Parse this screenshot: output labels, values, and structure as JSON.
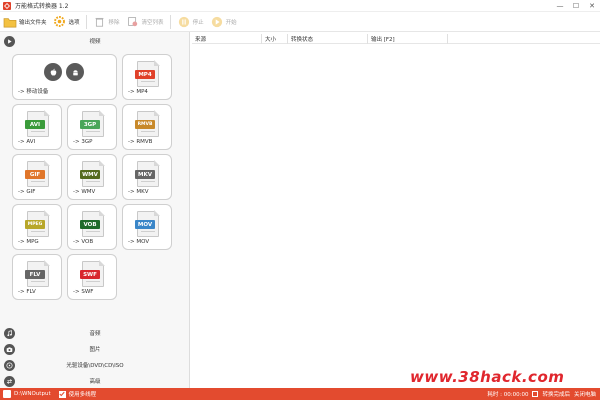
{
  "window": {
    "title": "万能格式转换器 1.2",
    "controls": [
      "minimize-icon",
      "maximize-icon",
      "close-icon"
    ]
  },
  "toolbar": {
    "output_folder": "输出文件夹",
    "options": "选项",
    "remove": "移除",
    "clear_list": "清空列表",
    "stop": "停止",
    "start": "开始"
  },
  "categories": {
    "video": "视频",
    "audio": "音频",
    "image": "图片",
    "disc": "光驱设备\\DVD\\CD\\ISO",
    "advanced": "高级"
  },
  "formats": [
    {
      "label": "-> 移动设备",
      "badge": "",
      "color": "#555555"
    },
    {
      "label": "-> MP4",
      "badge": "MP4",
      "color": "#e0412a"
    },
    {
      "label": "-> AVI",
      "badge": "AVI",
      "color": "#3a9b3a"
    },
    {
      "label": "-> 3GP",
      "badge": "3GP",
      "color": "#4aa65a"
    },
    {
      "label": "-> RMVB",
      "badge": "RMVB",
      "color": "#c8892a"
    },
    {
      "label": "-> GIF",
      "badge": "GIF",
      "color": "#e0762a"
    },
    {
      "label": "-> WMV",
      "badge": "WMV",
      "color": "#556b1f"
    },
    {
      "label": "-> MKV",
      "badge": "MKV",
      "color": "#666666"
    },
    {
      "label": "-> MPG",
      "badge": "MPEG",
      "color": "#b8a72a"
    },
    {
      "label": "-> VOB",
      "badge": "VOB",
      "color": "#1f6b2a"
    },
    {
      "label": "-> MOV",
      "badge": "MOV",
      "color": "#3a86c8"
    },
    {
      "label": "-> FLV",
      "badge": "FLV",
      "color": "#666666"
    },
    {
      "label": "-> SWF",
      "badge": "SWF",
      "color": "#d8262d"
    }
  ],
  "table": {
    "columns": [
      "来源",
      "大小",
      "转换状态",
      "输出 [F2]"
    ]
  },
  "watermark": "www.38hack.com",
  "statusbar": {
    "output_path": "D:\\WNOutput",
    "multithread": "使用多线程",
    "elapsed": "耗时 : 00:00:00",
    "after_convert": "转换完成后",
    "shutdown": "关闭电脑"
  },
  "colors": {
    "accent": "#e34b2f",
    "watermark": "#e0262d"
  }
}
